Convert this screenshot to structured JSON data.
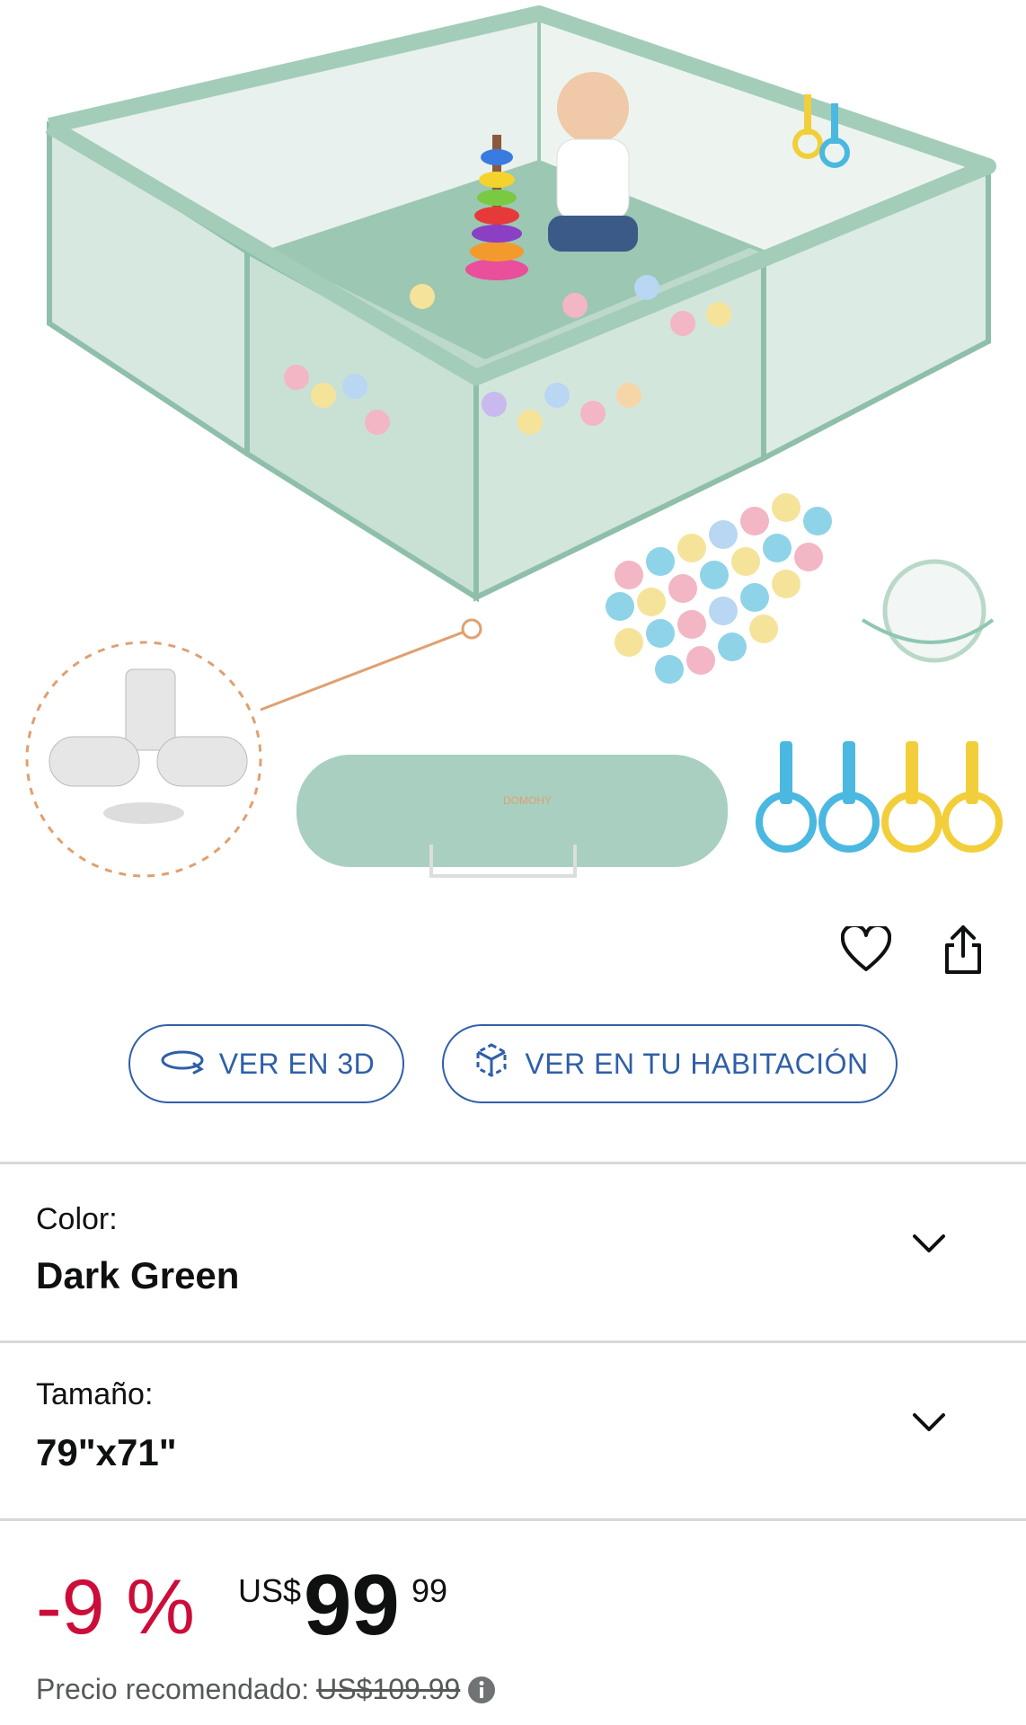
{
  "product": {
    "brand_on_bag": "DOMOHY"
  },
  "actions": {
    "view_3d": "VER EN 3D",
    "view_room": "VER EN TU HABITACIÓN"
  },
  "variations": {
    "color": {
      "label": "Color:",
      "value": "Dark Green"
    },
    "size": {
      "label": "Tamaño:",
      "value": "79\"x71\""
    }
  },
  "price": {
    "discount": "-9 %",
    "currency": "US$",
    "whole": "99",
    "fraction": "99",
    "list_label": "Precio recomendado:",
    "list_price": "US$109.99"
  },
  "colors": {
    "accent_blue": "#2f5fa8",
    "discount_red": "#cc0c39",
    "playpen_green": "#a8cfc0"
  },
  "icons": [
    "heart-icon",
    "share-icon",
    "rotate-3d-icon",
    "ar-cube-icon",
    "chevron-down-icon",
    "info-icon"
  ]
}
